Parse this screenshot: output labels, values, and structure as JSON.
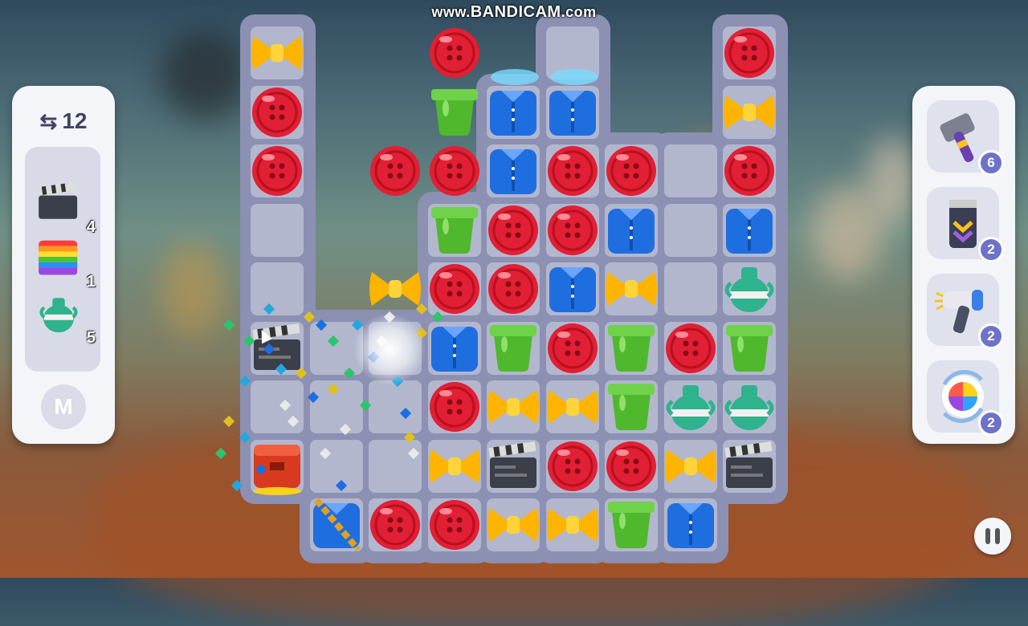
{
  "watermark": {
    "prefix": "www.",
    "brand": "BANDICAM",
    "suffix": ".com"
  },
  "moves": {
    "icon": "swap-icon",
    "count": "12"
  },
  "goals": [
    {
      "item": "clapperboard",
      "count": "4"
    },
    {
      "item": "rainbow-box",
      "count": "1"
    },
    {
      "item": "vase",
      "count": "5"
    }
  ],
  "menu_button": {
    "label": "M"
  },
  "boosters": [
    {
      "item": "hammer",
      "count": "6"
    },
    {
      "item": "tape-roller",
      "count": "2"
    },
    {
      "item": "hairdryer",
      "count": "2"
    },
    {
      "item": "shuffle",
      "count": "2"
    }
  ],
  "board": {
    "columns": 9,
    "rows": 9,
    "pieces": [
      [
        "bow",
        null,
        null,
        "button",
        null,
        null,
        null,
        null,
        "button"
      ],
      [
        "button",
        null,
        null,
        "pot",
        "shirt",
        "shirt",
        null,
        null,
        "bow"
      ],
      [
        "button",
        null,
        "button",
        "button",
        "shirt",
        "button",
        "button",
        null,
        "button"
      ],
      [
        null,
        null,
        null,
        "pot",
        "button",
        "button",
        "shirt",
        null,
        "shirt"
      ],
      [
        null,
        null,
        "bow",
        "button",
        "button",
        "shirt",
        "bow",
        null,
        "vase"
      ],
      [
        "clapperboard",
        null,
        null,
        "shirt",
        "pot",
        "button",
        "pot",
        "button",
        "pot"
      ],
      [
        null,
        null,
        null,
        "button",
        "bow",
        "bow",
        "pot",
        "vase",
        "vase"
      ],
      [
        "red-box",
        null,
        null,
        "bow",
        "clapperboard",
        "button",
        "button",
        "bow",
        "clapperboard"
      ],
      [
        null,
        "shirt-chained",
        "button",
        "button",
        "bow",
        "bow",
        "pot",
        "shirt",
        null
      ]
    ]
  },
  "colors": {
    "button": "#e11f35",
    "shirt": "#1f6ee0",
    "pot": "#4fb82c",
    "bow": "#ffb400",
    "vase": "#2eb38c",
    "board_frame": "#8c90b2",
    "cell": "#b2b7ce",
    "booster_badge": "#6f72c9"
  }
}
